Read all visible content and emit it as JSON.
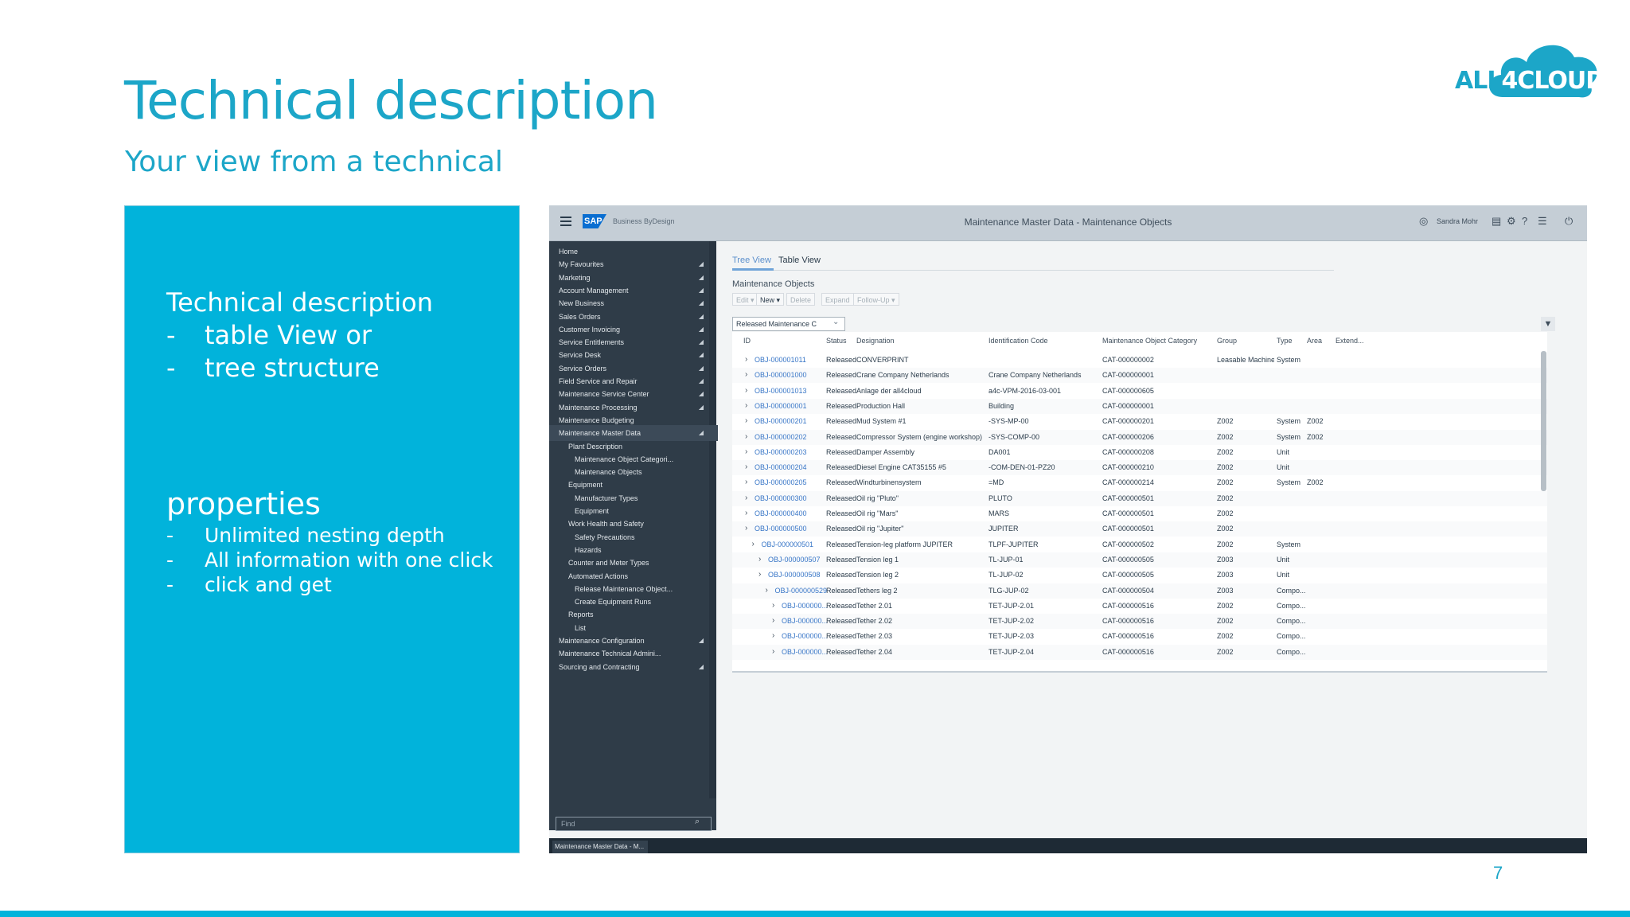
{
  "slide": {
    "title": "Technical description",
    "subtitle": "Your view from a technical",
    "page_number": "7",
    "logo": {
      "text_left": "ALL",
      "text_mid": "4",
      "text_right": "CLOUD"
    }
  },
  "info_panel": {
    "heading": "Technical description",
    "items": [
      {
        "dash": "-",
        "text": "table View or"
      },
      {
        "dash": "-",
        "text": "tree structure"
      }
    ],
    "properties_heading": "properties",
    "properties": [
      {
        "dash": "-",
        "text": "Unlimited nesting depth"
      },
      {
        "dash": "-",
        "text": "All information with one click"
      },
      {
        "dash": "-",
        "text": "click and get"
      }
    ]
  },
  "sap": {
    "header": {
      "logo": "SAP",
      "product": "Business ByDesign",
      "title": "Maintenance Master Data - Maintenance Objects",
      "user": "Sandra Mohr"
    },
    "nav": {
      "items": [
        {
          "label": "Home",
          "indent": 0,
          "arrow": false
        },
        {
          "label": "My Favourites",
          "indent": 0,
          "arrow": true
        },
        {
          "label": "Marketing",
          "indent": 0,
          "arrow": true
        },
        {
          "label": "Account Management",
          "indent": 0,
          "arrow": true
        },
        {
          "label": "New Business",
          "indent": 0,
          "arrow": true
        },
        {
          "label": "Sales Orders",
          "indent": 0,
          "arrow": true
        },
        {
          "label": "Customer Invoicing",
          "indent": 0,
          "arrow": true
        },
        {
          "label": "Service Entitlements",
          "indent": 0,
          "arrow": true
        },
        {
          "label": "Service Desk",
          "indent": 0,
          "arrow": true
        },
        {
          "label": "Service Orders",
          "indent": 0,
          "arrow": true
        },
        {
          "label": "Field Service and Repair",
          "indent": 0,
          "arrow": true
        },
        {
          "label": "Maintenance Service Center",
          "indent": 0,
          "arrow": true
        },
        {
          "label": "Maintenance Processing",
          "indent": 0,
          "arrow": true
        },
        {
          "label": "Maintenance Budgeting",
          "indent": 0,
          "arrow": false
        },
        {
          "label": "Maintenance Master Data",
          "indent": 0,
          "arrow": true,
          "active": true
        },
        {
          "label": "Plant Description",
          "indent": 1,
          "arrow": false
        },
        {
          "label": "Maintenance Object Categori...",
          "indent": 2,
          "arrow": false
        },
        {
          "label": "Maintenance Objects",
          "indent": 2,
          "arrow": false
        },
        {
          "label": "Equipment",
          "indent": 1,
          "arrow": false
        },
        {
          "label": "Manufacturer Types",
          "indent": 2,
          "arrow": false
        },
        {
          "label": "Equipment",
          "indent": 2,
          "arrow": false
        },
        {
          "label": "Work Health and Safety",
          "indent": 1,
          "arrow": false
        },
        {
          "label": "Safety Precautions",
          "indent": 2,
          "arrow": false
        },
        {
          "label": "Hazards",
          "indent": 2,
          "arrow": false
        },
        {
          "label": "Counter and Meter Types",
          "indent": 1,
          "arrow": false
        },
        {
          "label": "Automated Actions",
          "indent": 1,
          "arrow": false
        },
        {
          "label": "Release Maintenance Object...",
          "indent": 2,
          "arrow": false
        },
        {
          "label": "Create Equipment Runs",
          "indent": 2,
          "arrow": false
        },
        {
          "label": "Reports",
          "indent": 1,
          "arrow": false
        },
        {
          "label": "List",
          "indent": 2,
          "arrow": false
        },
        {
          "label": "Maintenance Configuration",
          "indent": 0,
          "arrow": true
        },
        {
          "label": "Maintenance Technical Admini...",
          "indent": 0,
          "arrow": false
        },
        {
          "label": "Sourcing and Contracting",
          "indent": 0,
          "arrow": true
        }
      ],
      "search_placeholder": "Find"
    },
    "tabs": [
      {
        "label": "Tree View",
        "active": true
      },
      {
        "label": "Table View",
        "active": false
      }
    ],
    "section_title": "Maintenance Objects",
    "toolbar": [
      {
        "label": "Edit",
        "enabled": false
      },
      {
        "label": "New",
        "enabled": true
      },
      {
        "label": "Delete",
        "enabled": false
      },
      {
        "label": "Expand",
        "enabled": false
      },
      {
        "label": "Follow-Up",
        "enabled": false
      }
    ],
    "filter_value": "Released Maintenance C",
    "table": {
      "columns": [
        "ID",
        "Status",
        "Designation",
        "Identification Code",
        "Maintenance Object Category",
        "Group",
        "Type",
        "Area",
        "Extend..."
      ],
      "rows": [
        {
          "level": 0,
          "id": "OBJ-000001011",
          "status": "Released",
          "designation": "CONVERPRINT",
          "code": "",
          "category": "CAT-000000002",
          "group": "Leasable Machine",
          "type": "System",
          "area": ""
        },
        {
          "level": 0,
          "id": "OBJ-000001000",
          "status": "Released",
          "designation": "Crane Company Netherlands",
          "code": "Crane Company Netherlands",
          "category": "CAT-000000001",
          "group": "",
          "type": "",
          "area": ""
        },
        {
          "level": 0,
          "id": "OBJ-000001013",
          "status": "Released",
          "designation": "Anlage der all4cloud",
          "code": "a4c-VPM-2016-03-001",
          "category": "CAT-000000605",
          "group": "",
          "type": "",
          "area": ""
        },
        {
          "level": 0,
          "id": "OBJ-000000001",
          "status": "Released",
          "designation": "Production Hall",
          "code": "Building",
          "category": "CAT-000000001",
          "group": "",
          "type": "",
          "area": ""
        },
        {
          "level": 0,
          "id": "OBJ-000000201",
          "status": "Released",
          "designation": "Mud System #1",
          "code": "-SYS-MP-00",
          "category": "CAT-000000201",
          "group": "Z002",
          "type": "System",
          "area": "Z002"
        },
        {
          "level": 0,
          "id": "OBJ-000000202",
          "status": "Released",
          "designation": "Compressor System (engine workshop)",
          "code": "-SYS-COMP-00",
          "category": "CAT-000000206",
          "group": "Z002",
          "type": "System",
          "area": "Z002"
        },
        {
          "level": 0,
          "id": "OBJ-000000203",
          "status": "Released",
          "designation": "Damper Assembly",
          "code": "DA001",
          "category": "CAT-000000208",
          "group": "Z002",
          "type": "Unit",
          "area": ""
        },
        {
          "level": 0,
          "id": "OBJ-000000204",
          "status": "Released",
          "designation": "Diesel Engine CAT35155 #5",
          "code": "-COM-DEN-01-PZ20",
          "category": "CAT-000000210",
          "group": "Z002",
          "type": "Unit",
          "area": ""
        },
        {
          "level": 0,
          "id": "OBJ-000000205",
          "status": "Released",
          "designation": "Windturbinensystem",
          "code": "=MD",
          "category": "CAT-000000214",
          "group": "Z002",
          "type": "System",
          "area": "Z002"
        },
        {
          "level": 0,
          "id": "OBJ-000000300",
          "status": "Released",
          "designation": "Oil rig \"Pluto\"",
          "code": "PLUTO",
          "category": "CAT-000000501",
          "group": "Z002",
          "type": "",
          "area": ""
        },
        {
          "level": 0,
          "id": "OBJ-000000400",
          "status": "Released",
          "designation": "Oil rig \"Mars\"",
          "code": "MARS",
          "category": "CAT-000000501",
          "group": "Z002",
          "type": "",
          "area": ""
        },
        {
          "level": 0,
          "id": "OBJ-000000500",
          "status": "Released",
          "designation": "Oil rig \"Jupiter\"",
          "code": "JUPITER",
          "category": "CAT-000000501",
          "group": "Z002",
          "type": "",
          "area": ""
        },
        {
          "level": 1,
          "id": "OBJ-000000501",
          "status": "Released",
          "designation": "Tension-leg platform JUPITER",
          "code": "TLPF-JUPITER",
          "category": "CAT-000000502",
          "group": "Z002",
          "type": "System",
          "area": ""
        },
        {
          "level": 2,
          "id": "OBJ-000000507",
          "status": "Released",
          "designation": "Tension leg 1",
          "code": "TL-JUP-01",
          "category": "CAT-000000505",
          "group": "Z003",
          "type": "Unit",
          "area": ""
        },
        {
          "level": 2,
          "id": "OBJ-000000508",
          "status": "Released",
          "designation": "Tension leg 2",
          "code": "TL-JUP-02",
          "category": "CAT-000000505",
          "group": "Z003",
          "type": "Unit",
          "area": ""
        },
        {
          "level": 3,
          "id": "OBJ-000000529",
          "status": "Released",
          "designation": "Tethers leg 2",
          "code": "TLG-JUP-02",
          "category": "CAT-000000504",
          "group": "Z003",
          "type": "Compo...",
          "area": ""
        },
        {
          "level": 4,
          "id": "OBJ-000000...",
          "status": "Released",
          "designation": "Tether 2.01",
          "code": "TET-JUP-2.01",
          "category": "CAT-000000516",
          "group": "Z002",
          "type": "Compo...",
          "area": ""
        },
        {
          "level": 4,
          "id": "OBJ-000000...",
          "status": "Released",
          "designation": "Tether 2.02",
          "code": "TET-JUP-2.02",
          "category": "CAT-000000516",
          "group": "Z002",
          "type": "Compo...",
          "area": ""
        },
        {
          "level": 4,
          "id": "OBJ-000000...",
          "status": "Released",
          "designation": "Tether 2.03",
          "code": "TET-JUP-2.03",
          "category": "CAT-000000516",
          "group": "Z002",
          "type": "Compo...",
          "area": ""
        },
        {
          "level": 4,
          "id": "OBJ-000000...",
          "status": "Released",
          "designation": "Tether 2.04",
          "code": "TET-JUP-2.04",
          "category": "CAT-000000516",
          "group": "Z002",
          "type": "Compo...",
          "area": ""
        }
      ]
    },
    "footer_tab": "Maintenance Master Data - M...",
    "icons": [
      "user-icon",
      "calendar-icon",
      "settings-icon",
      "help-icon",
      "list-icon",
      "power-icon"
    ]
  }
}
